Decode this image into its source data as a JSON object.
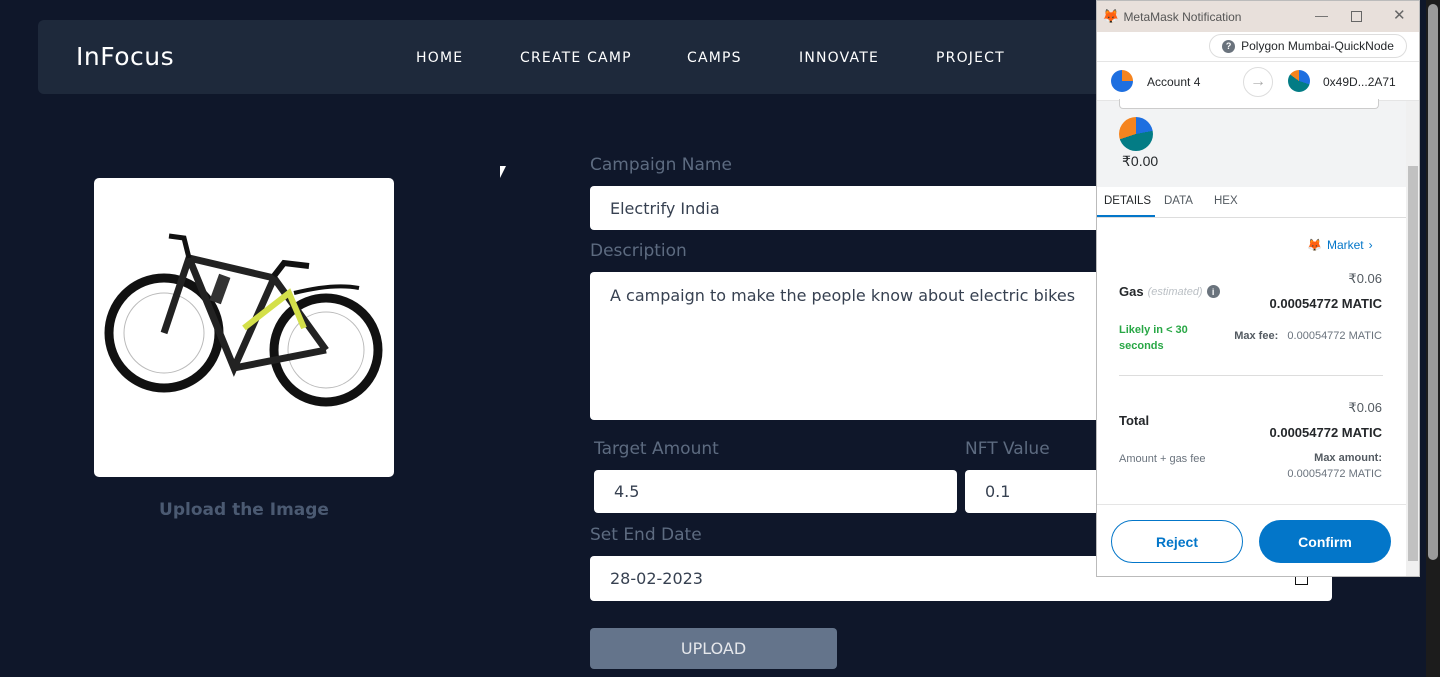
{
  "app": {
    "logo": "InFocus",
    "nav": [
      "HOME",
      "CREATE CAMP",
      "CAMPS",
      "INNOVATE",
      "PROJECT"
    ]
  },
  "form": {
    "upload_image_label": "Upload the Image",
    "campaign_name_label": "Campaign Name",
    "campaign_name_value": "Electrify India",
    "description_label": "Description",
    "description_value": "A campaign to make the people know about electric bikes",
    "target_amount_label": "Target Amount",
    "target_amount_value": "4.5",
    "nft_value_label": "NFT Value",
    "nft_value_value": "0.1",
    "end_date_label": "Set End Date",
    "end_date_value": "28-02-2023",
    "upload_button": "UPLOAD"
  },
  "metamask": {
    "window_title": "MetaMask Notification",
    "network": "Polygon Mumbai-QuickNode",
    "from_account": "Account 4",
    "to_address": "0x49D...2A71",
    "amount_fiat": "₹0.00",
    "tabs": [
      "DETAILS",
      "DATA",
      "HEX"
    ],
    "active_tab": "DETAILS",
    "market_label": "Market",
    "gas_label": "Gas",
    "gas_estimated": "(estimated)",
    "gas_fiat": "₹0.06",
    "gas_native": "0.00054772 MATIC",
    "likely": "Likely in < 30 seconds",
    "max_fee_label": "Max fee:",
    "max_fee_value": "0.00054772 MATIC",
    "total_label": "Total",
    "total_fiat": "₹0.06",
    "total_native": "0.00054772 MATIC",
    "amount_gas_fee": "Amount + gas fee",
    "max_amount_label": "Max amount:",
    "max_amount_value": "0.00054772 MATIC",
    "reject": "Reject",
    "confirm": "Confirm",
    "colors": {
      "primary": "#0376c9",
      "success": "#28a745",
      "title_bar": "#e8e0db"
    }
  }
}
